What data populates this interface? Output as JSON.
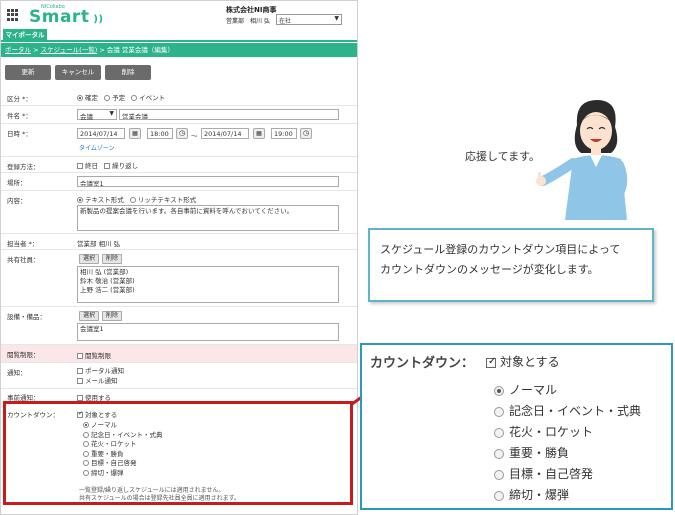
{
  "header": {
    "brand_top": "NICollabo",
    "brand": "Smart",
    "company": "株式会社NI商事",
    "user": "営業部　相川 弘",
    "status": "在社"
  },
  "tabs": {
    "active": "マイポータル"
  },
  "breadcrumb": {
    "portal": "ポータル",
    "schedule": "スケジュール(一覧)",
    "current": "会議 営業会議（編集）",
    "sep": ">"
  },
  "toolbar": {
    "update": "更新",
    "cancel": "キャンセル",
    "delete": "削除"
  },
  "form": {
    "category": {
      "label": "区分 *：",
      "options": [
        "確定",
        "予定",
        "イベント"
      ],
      "selected": 0
    },
    "subject": {
      "label": "件名 *：",
      "type": "会議",
      "value": "営業会議"
    },
    "datetime": {
      "label": "日時 *：",
      "start_date": "2014/07/14",
      "start_time": "18:00",
      "tilde": "～",
      "end_date": "2014/07/14",
      "end_time": "19:00",
      "timezone": "タイムゾーン"
    },
    "registration": {
      "label": "登録方法：",
      "all_day": "終日",
      "repeat": "繰り返し"
    },
    "place": {
      "label": "場所：",
      "value": "会議室1"
    },
    "content": {
      "label": "内容：",
      "text_format": "テキスト形式",
      "rich_format": "リッチテキスト形式",
      "value": "新製品の提案会議を行います。各自事前に資料を呼んでおいてください。"
    },
    "owner": {
      "label": "担当者 *：",
      "value": "営業部 相川 弘"
    },
    "members": {
      "label": "共有社員：",
      "select": "選択",
      "remove": "削除",
      "list": [
        "相川 弘 (営業部)",
        "鈴木 敬治 (営業部)",
        "上野 浩二 (営業部)"
      ]
    },
    "equipment": {
      "label": "設備・備品：",
      "select": "選択",
      "remove": "削除",
      "list": [
        "会議室1"
      ]
    },
    "restriction": {
      "label": "閲覧制限：",
      "option": "閲覧制限"
    },
    "notify": {
      "label": "通知：",
      "portal": "ポータル通知",
      "mail": "メール通知"
    },
    "pre_notify": {
      "label": "事前通知：",
      "option": "使用する"
    },
    "countdown": {
      "label": "カウントダウン：",
      "target": "対象とする",
      "options": [
        "ノーマル",
        "記念日・イベント・式典",
        "花火・ロケット",
        "重要・勝負",
        "目標・自己啓発",
        "締切・爆弾"
      ],
      "selected": 0,
      "note1": "一覧登録/繰り返しスケジュールには適用されません。",
      "note2": "共有スケジュールの場合は登録先社員全員に適用されます。"
    }
  },
  "speech": "応援してます。",
  "explanation": [
    "スケジュール登録のカウントダウン項目によって",
    "カウントダウンのメッセージが変化します。"
  ],
  "zoom": {
    "label": "カウントダウン：",
    "target": "対象とする",
    "options": [
      "ノーマル",
      "記念日・イベント・式典",
      "花火・ロケット",
      "重要・勝負",
      "目標・自己啓発",
      "締切・爆弾"
    ]
  },
  "colors": {
    "brand": "#2bb38a",
    "highlight": "#c81b1b",
    "callout": "#2a9ab8"
  }
}
